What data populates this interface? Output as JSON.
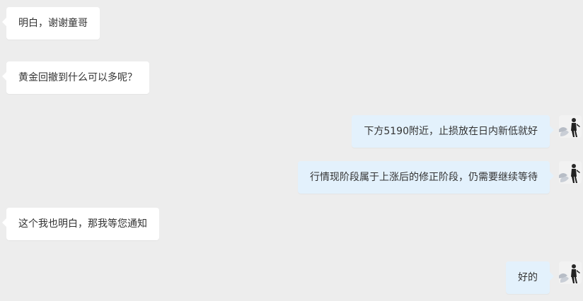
{
  "messages": [
    {
      "side": "in",
      "text": "明白，谢谢童哥"
    },
    {
      "side": "in",
      "text": "黄金回撤到什么可以多呢？"
    },
    {
      "side": "out",
      "text": "下方5190附近，止损放在日内新低就好"
    },
    {
      "side": "out",
      "text": "行情现阶段属于上涨后的修正阶段，仍需要继续等待"
    },
    {
      "side": "in",
      "text": "这个我也明白，那我等您通知"
    },
    {
      "side": "out",
      "text": "好的"
    }
  ],
  "colors": {
    "background": "#ededed",
    "incoming_bubble": "#ffffff",
    "outgoing_bubble": "#e3f1fc",
    "text": "#333333"
  },
  "icons": {
    "avatar": "user-avatar-icon"
  }
}
